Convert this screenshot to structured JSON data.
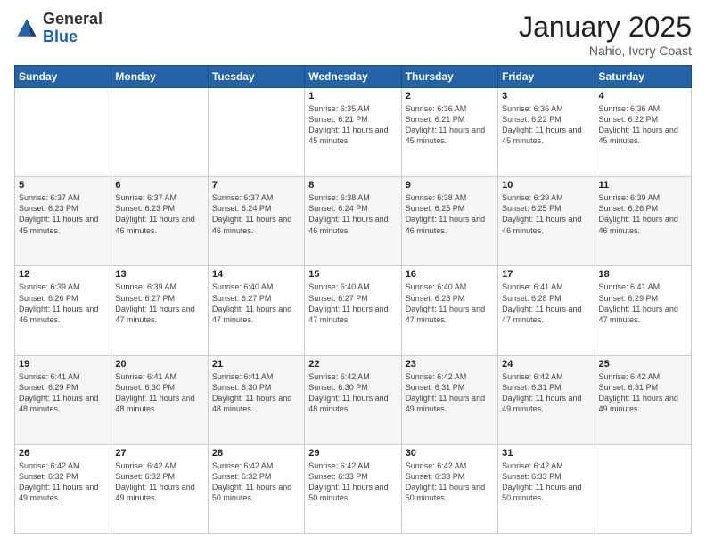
{
  "logo": {
    "general": "General",
    "blue": "Blue"
  },
  "title": "January 2025",
  "subtitle": "Nahio, Ivory Coast",
  "weekdays": [
    "Sunday",
    "Monday",
    "Tuesday",
    "Wednesday",
    "Thursday",
    "Friday",
    "Saturday"
  ],
  "weeks": [
    [
      {
        "day": "",
        "sunrise": "",
        "sunset": "",
        "daylight": ""
      },
      {
        "day": "",
        "sunrise": "",
        "sunset": "",
        "daylight": ""
      },
      {
        "day": "",
        "sunrise": "",
        "sunset": "",
        "daylight": ""
      },
      {
        "day": "1",
        "sunrise": "Sunrise: 6:35 AM",
        "sunset": "Sunset: 6:21 PM",
        "daylight": "Daylight: 11 hours and 45 minutes."
      },
      {
        "day": "2",
        "sunrise": "Sunrise: 6:36 AM",
        "sunset": "Sunset: 6:21 PM",
        "daylight": "Daylight: 11 hours and 45 minutes."
      },
      {
        "day": "3",
        "sunrise": "Sunrise: 6:36 AM",
        "sunset": "Sunset: 6:22 PM",
        "daylight": "Daylight: 11 hours and 45 minutes."
      },
      {
        "day": "4",
        "sunrise": "Sunrise: 6:36 AM",
        "sunset": "Sunset: 6:22 PM",
        "daylight": "Daylight: 11 hours and 45 minutes."
      }
    ],
    [
      {
        "day": "5",
        "sunrise": "Sunrise: 6:37 AM",
        "sunset": "Sunset: 6:23 PM",
        "daylight": "Daylight: 11 hours and 45 minutes."
      },
      {
        "day": "6",
        "sunrise": "Sunrise: 6:37 AM",
        "sunset": "Sunset: 6:23 PM",
        "daylight": "Daylight: 11 hours and 46 minutes."
      },
      {
        "day": "7",
        "sunrise": "Sunrise: 6:37 AM",
        "sunset": "Sunset: 6:24 PM",
        "daylight": "Daylight: 11 hours and 46 minutes."
      },
      {
        "day": "8",
        "sunrise": "Sunrise: 6:38 AM",
        "sunset": "Sunset: 6:24 PM",
        "daylight": "Daylight: 11 hours and 46 minutes."
      },
      {
        "day": "9",
        "sunrise": "Sunrise: 6:38 AM",
        "sunset": "Sunset: 6:25 PM",
        "daylight": "Daylight: 11 hours and 46 minutes."
      },
      {
        "day": "10",
        "sunrise": "Sunrise: 6:39 AM",
        "sunset": "Sunset: 6:25 PM",
        "daylight": "Daylight: 11 hours and 46 minutes."
      },
      {
        "day": "11",
        "sunrise": "Sunrise: 6:39 AM",
        "sunset": "Sunset: 6:26 PM",
        "daylight": "Daylight: 11 hours and 46 minutes."
      }
    ],
    [
      {
        "day": "12",
        "sunrise": "Sunrise: 6:39 AM",
        "sunset": "Sunset: 6:26 PM",
        "daylight": "Daylight: 11 hours and 46 minutes."
      },
      {
        "day": "13",
        "sunrise": "Sunrise: 6:39 AM",
        "sunset": "Sunset: 6:27 PM",
        "daylight": "Daylight: 11 hours and 47 minutes."
      },
      {
        "day": "14",
        "sunrise": "Sunrise: 6:40 AM",
        "sunset": "Sunset: 6:27 PM",
        "daylight": "Daylight: 11 hours and 47 minutes."
      },
      {
        "day": "15",
        "sunrise": "Sunrise: 6:40 AM",
        "sunset": "Sunset: 6:27 PM",
        "daylight": "Daylight: 11 hours and 47 minutes."
      },
      {
        "day": "16",
        "sunrise": "Sunrise: 6:40 AM",
        "sunset": "Sunset: 6:28 PM",
        "daylight": "Daylight: 11 hours and 47 minutes."
      },
      {
        "day": "17",
        "sunrise": "Sunrise: 6:41 AM",
        "sunset": "Sunset: 6:28 PM",
        "daylight": "Daylight: 11 hours and 47 minutes."
      },
      {
        "day": "18",
        "sunrise": "Sunrise: 6:41 AM",
        "sunset": "Sunset: 6:29 PM",
        "daylight": "Daylight: 11 hours and 47 minutes."
      }
    ],
    [
      {
        "day": "19",
        "sunrise": "Sunrise: 6:41 AM",
        "sunset": "Sunset: 6:29 PM",
        "daylight": "Daylight: 11 hours and 48 minutes."
      },
      {
        "day": "20",
        "sunrise": "Sunrise: 6:41 AM",
        "sunset": "Sunset: 6:30 PM",
        "daylight": "Daylight: 11 hours and 48 minutes."
      },
      {
        "day": "21",
        "sunrise": "Sunrise: 6:41 AM",
        "sunset": "Sunset: 6:30 PM",
        "daylight": "Daylight: 11 hours and 48 minutes."
      },
      {
        "day": "22",
        "sunrise": "Sunrise: 6:42 AM",
        "sunset": "Sunset: 6:30 PM",
        "daylight": "Daylight: 11 hours and 48 minutes."
      },
      {
        "day": "23",
        "sunrise": "Sunrise: 6:42 AM",
        "sunset": "Sunset: 6:31 PM",
        "daylight": "Daylight: 11 hours and 49 minutes."
      },
      {
        "day": "24",
        "sunrise": "Sunrise: 6:42 AM",
        "sunset": "Sunset: 6:31 PM",
        "daylight": "Daylight: 11 hours and 49 minutes."
      },
      {
        "day": "25",
        "sunrise": "Sunrise: 6:42 AM",
        "sunset": "Sunset: 6:31 PM",
        "daylight": "Daylight: 11 hours and 49 minutes."
      }
    ],
    [
      {
        "day": "26",
        "sunrise": "Sunrise: 6:42 AM",
        "sunset": "Sunset: 6:32 PM",
        "daylight": "Daylight: 11 hours and 49 minutes."
      },
      {
        "day": "27",
        "sunrise": "Sunrise: 6:42 AM",
        "sunset": "Sunset: 6:32 PM",
        "daylight": "Daylight: 11 hours and 49 minutes."
      },
      {
        "day": "28",
        "sunrise": "Sunrise: 6:42 AM",
        "sunset": "Sunset: 6:32 PM",
        "daylight": "Daylight: 11 hours and 50 minutes."
      },
      {
        "day": "29",
        "sunrise": "Sunrise: 6:42 AM",
        "sunset": "Sunset: 6:33 PM",
        "daylight": "Daylight: 11 hours and 50 minutes."
      },
      {
        "day": "30",
        "sunrise": "Sunrise: 6:42 AM",
        "sunset": "Sunset: 6:33 PM",
        "daylight": "Daylight: 11 hours and 50 minutes."
      },
      {
        "day": "31",
        "sunrise": "Sunrise: 6:42 AM",
        "sunset": "Sunset: 6:33 PM",
        "daylight": "Daylight: 11 hours and 50 minutes."
      },
      {
        "day": "",
        "sunrise": "",
        "sunset": "",
        "daylight": ""
      }
    ]
  ]
}
